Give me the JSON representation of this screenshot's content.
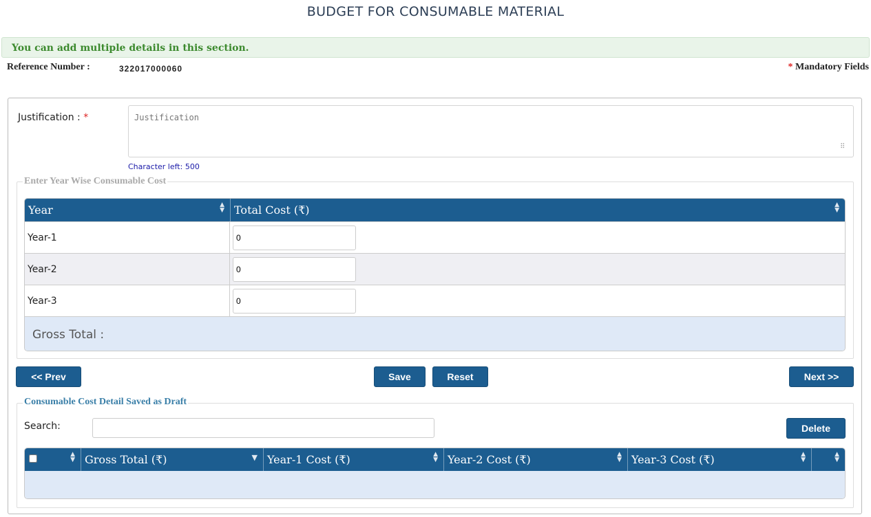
{
  "page": {
    "title": "BUDGET FOR CONSUMABLE MATERIAL",
    "info_message": "You can add multiple details in this section.",
    "reference_label": "Reference Number :",
    "reference_value": "322017000060",
    "mandatory_star": "*",
    "mandatory_label": "Mandatory Fields"
  },
  "justification": {
    "label": "Justification :",
    "required_star": "*",
    "placeholder": "Justification",
    "char_left": "Character left: 500"
  },
  "year_cost": {
    "legend": "Enter Year Wise Consumable Cost",
    "headers": {
      "year": "Year",
      "total_cost": "Total Cost (₹)"
    },
    "rows": [
      {
        "year": "Year-1",
        "value": "0"
      },
      {
        "year": "Year-2",
        "value": "0"
      },
      {
        "year": "Year-3",
        "value": "0"
      }
    ],
    "gross_total_label": "Gross Total :"
  },
  "buttons": {
    "prev": "<< Prev",
    "save": "Save",
    "reset": "Reset",
    "next": "Next >>",
    "delete": "Delete"
  },
  "draft": {
    "legend": "Consumable Cost Detail Saved as Draft",
    "search_label": "Search:",
    "headers": {
      "gross_total": "Gross Total (₹)",
      "year1": "Year-1 Cost (₹)",
      "year2": "Year-2 Cost (₹)",
      "year3": "Year-3 Cost (₹)"
    }
  },
  "icons": {
    "sort": "sort-both-icon",
    "sort_active": "sort-down-icon",
    "resize": "resize-grip-icon"
  },
  "colors": {
    "header_blue": "#1c5d90",
    "info_green": "#3c8a2e",
    "required_red": "#dd2222",
    "char_left_blue": "#1a1aa8"
  }
}
